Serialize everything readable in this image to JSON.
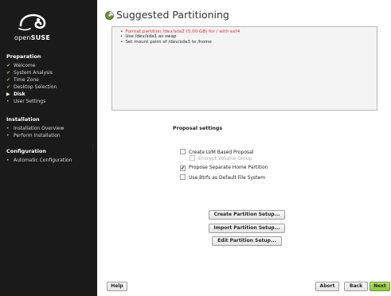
{
  "sidebar": {
    "brand": {
      "prefix": "open",
      "suffix": "SUSE"
    },
    "sections": [
      {
        "title": "Preparation",
        "steps": [
          {
            "label": "Welcome",
            "state": "done"
          },
          {
            "label": "System Analysis",
            "state": "done"
          },
          {
            "label": "Time Zone",
            "state": "done"
          },
          {
            "label": "Desktop Selection",
            "state": "done"
          },
          {
            "label": "Disk",
            "state": "current"
          },
          {
            "label": "User Settings",
            "state": "pending"
          }
        ]
      },
      {
        "title": "Installation",
        "steps": [
          {
            "label": "Installation Overview",
            "state": "pending"
          },
          {
            "label": "Perform Installation",
            "state": "pending"
          }
        ]
      },
      {
        "title": "Configuration",
        "steps": [
          {
            "label": "Automatic Configuration",
            "state": "pending"
          }
        ]
      }
    ],
    "marks": {
      "done": "✔",
      "current": "▶",
      "pending": "•"
    }
  },
  "main": {
    "title": "Suggested Partitioning",
    "summary": [
      {
        "text": "Format partition /dev/sda2 (5.00 GB) for / with ext4",
        "highlight": true
      },
      {
        "text": "Use /dev/sda1 as swap",
        "highlight": false
      },
      {
        "text": "Set mount point of /dev/sda3 to /home",
        "highlight": false
      }
    ],
    "proposal_heading": "Proposal settings",
    "options": {
      "lvm": {
        "label": "Create LVM Based Proposal",
        "checked": false
      },
      "encrypt": {
        "label": "Encrypt Volume Group",
        "checked": false,
        "disabled": true
      },
      "home": {
        "label": "Propose Separate Home Partition",
        "checked": true
      },
      "btrfs": {
        "label": "Use Btrfs as Default File System",
        "checked": false
      }
    },
    "actions": {
      "create": "Create Partition Setup...",
      "import": "Import Partition Setup...",
      "edit": "Edit Partition Setup..."
    }
  },
  "footer": {
    "help": "Help",
    "abort": "Abort",
    "back": "Back",
    "next": "Next"
  },
  "colors": {
    "sidebar_bg": "#1a1a1a",
    "accent_green": "#8cc83c",
    "warning_red": "#e0302c"
  }
}
